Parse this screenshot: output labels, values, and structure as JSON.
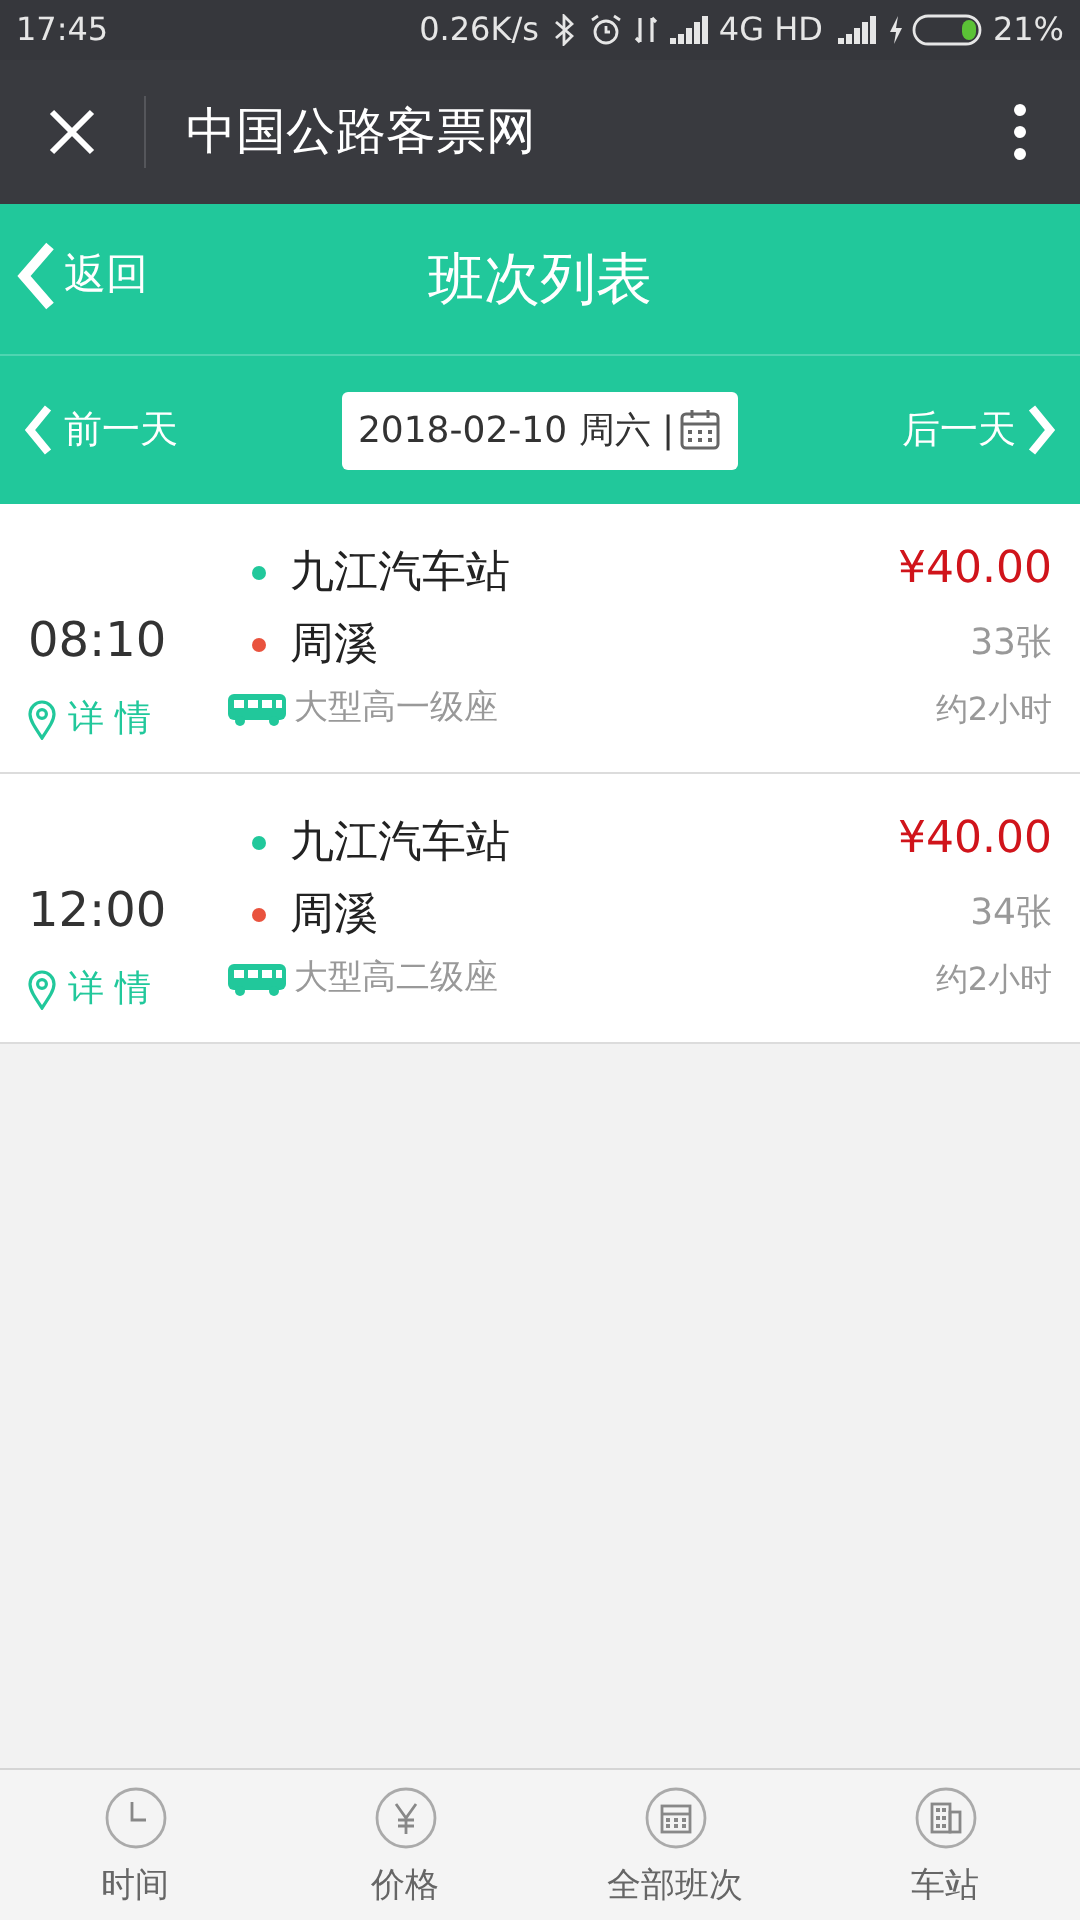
{
  "status_bar": {
    "time": "17:45",
    "speed": "0.26K/s",
    "network": "4G HD",
    "battery": "21%"
  },
  "title_bar": {
    "title": "中国公路客票网"
  },
  "header": {
    "back": "返回",
    "title": "班次列表"
  },
  "date_bar": {
    "prev": "前一天",
    "date": "2018-02-10 周六 |",
    "next": "后一天"
  },
  "trips": [
    {
      "time": "08:10",
      "details": "详 情",
      "from": "九江汽车站",
      "to": "周溪",
      "bus_type": "大型高一级座",
      "price": "¥40.00",
      "tickets": "33张",
      "duration": "约2小时"
    },
    {
      "time": "12:00",
      "details": "详 情",
      "from": "九江汽车站",
      "to": "周溪",
      "bus_type": "大型高二级座",
      "price": "¥40.00",
      "tickets": "34张",
      "duration": "约2小时"
    }
  ],
  "tabs": [
    {
      "label": "时间",
      "kind": "clock"
    },
    {
      "label": "价格",
      "kind": "yen"
    },
    {
      "label": "全部班次",
      "kind": "calendar"
    },
    {
      "label": "车站",
      "kind": "building"
    }
  ]
}
